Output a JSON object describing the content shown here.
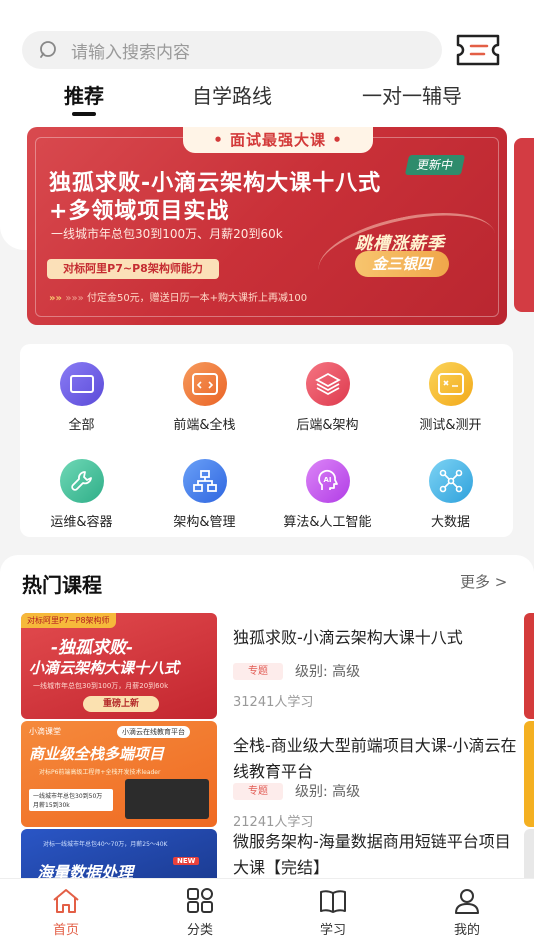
{
  "search": {
    "placeholder": "请输入搜索内容"
  },
  "tabs": [
    {
      "label": "推荐",
      "active": true
    },
    {
      "label": "自学路线",
      "active": false
    },
    {
      "label": "一对一辅导",
      "active": false
    }
  ],
  "banner": {
    "top_label": "• 面试最强大课 •",
    "title_line1": "独孤求败-小滴云架构大课十八式",
    "title_line2": "+多领域项目实战",
    "update_badge": "更新中",
    "subtitle": "一线城市年总包30到100万、月薪20到60k",
    "pill": "对标阿里P7~P8架构师能力",
    "bottom_text": "付定金50元，赠送日历一本+购大课折上再减100",
    "slogan1": "跳槽涨薪季",
    "slogan2": "金三银四"
  },
  "categories": [
    {
      "label": "全部",
      "icon": "browser-icon",
      "color": "#6c5ce7"
    },
    {
      "label": "前端&全栈",
      "icon": "code-window-icon",
      "color": "#f07838"
    },
    {
      "label": "后端&架构",
      "icon": "layers-icon",
      "color": "#ea4d5e"
    },
    {
      "label": "测试&测开",
      "icon": "test-screen-icon",
      "color": "#f5b920"
    },
    {
      "label": "运维&容器",
      "icon": "wrench-icon",
      "color": "#3fbf9a"
    },
    {
      "label": "架构&管理",
      "icon": "org-chart-icon",
      "color": "#3d7cf0"
    },
    {
      "label": "算法&人工智能",
      "icon": "ai-head-icon",
      "color": "#c45bf0"
    },
    {
      "label": "大数据",
      "icon": "network-icon",
      "color": "#47b8e8"
    }
  ],
  "hot": {
    "title": "热门课程",
    "more": "更多 >",
    "courses": [
      {
        "title": "独孤求败-小滴云架构大课十八式",
        "tag": "专题",
        "level": "级别: 高级",
        "count": "31241人学习",
        "thumb_line1": "-独孤求败-",
        "thumb_line2": "小滴云架构大课十八式",
        "thumb_badge": "对标阿里P7~P8架构师",
        "thumb_sub": "一线城市年总包30到100万，月薪20到60k",
        "thumb_button": "重磅上新",
        "thumb_color": "#d63a3e"
      },
      {
        "title": "全栈-商业级大型前端项目大课-小滴云在线教育平台",
        "tag": "专题",
        "level": "级别: 高级",
        "count": "21241人学习",
        "thumb_line1": "商业级全栈多端项目",
        "thumb_badge": "小滴课堂",
        "thumb_sub": "对标P6前端高级工程师+全栈开发技术leader",
        "thumb_note": "一线城市年总包30到50万\n月薪15到30k",
        "thumb_screen": "小滴云在线教育平台",
        "thumb_color": "#f0792e"
      },
      {
        "title": "微服务架构-海量数据商用短链平台项目大课【完结】",
        "thumb_line1": "海量数据处理",
        "thumb_badge": "NEW",
        "thumb_sub": "对标一线城市年总包40～70万，月薪25～40K",
        "thumb_color": "#1d3f9a"
      }
    ]
  },
  "navbar": [
    {
      "label": "首页",
      "icon": "home-icon",
      "active": true
    },
    {
      "label": "分类",
      "icon": "grid-icon",
      "active": false
    },
    {
      "label": "学习",
      "icon": "book-icon",
      "active": false
    },
    {
      "label": "我的",
      "icon": "user-icon",
      "active": false
    }
  ],
  "colors": {
    "accent": "#e35f46",
    "banner_red": "#c93038"
  }
}
